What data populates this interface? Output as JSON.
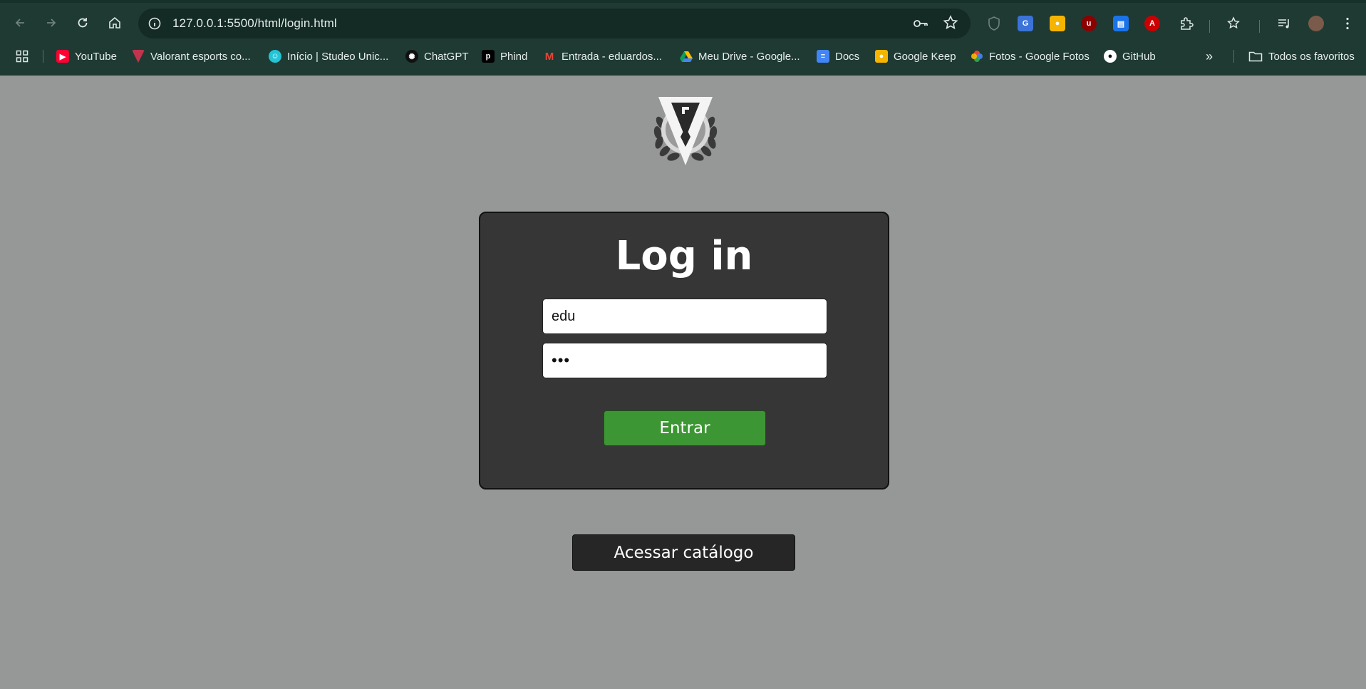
{
  "browser": {
    "url": "127.0.0.1:5500/html/login.html",
    "bookmarks": [
      {
        "label": "YouTube",
        "icon": "youtube-icon"
      },
      {
        "label": "Valorant esports co...",
        "icon": "valorant-icon"
      },
      {
        "label": "Início | Studeo Unic...",
        "icon": "studeo-icon"
      },
      {
        "label": "ChatGPT",
        "icon": "chatgpt-icon"
      },
      {
        "label": "Phind",
        "icon": "phind-icon"
      },
      {
        "label": "Entrada - eduardos...",
        "icon": "gmail-icon"
      },
      {
        "label": "Meu Drive - Google...",
        "icon": "drive-icon"
      },
      {
        "label": "Docs",
        "icon": "docs-icon"
      },
      {
        "label": "Google Keep",
        "icon": "keep-icon"
      },
      {
        "label": "Fotos - Google Fotos",
        "icon": "photos-icon"
      },
      {
        "label": "GitHub",
        "icon": "github-icon"
      }
    ],
    "all_bookmarks_label": "Todos os favoritos",
    "colors": {
      "chrome": "#1f3a33",
      "omnibox": "#142a24"
    }
  },
  "page": {
    "background": "#969897",
    "login": {
      "title": "Log in",
      "username_value": "edu",
      "password_value": "•••",
      "submit_label": "Entrar"
    },
    "catalog_button_label": "Acessar catálogo",
    "colors": {
      "card": "#363636",
      "submit": "#3d9634",
      "catalog": "#262626"
    }
  }
}
